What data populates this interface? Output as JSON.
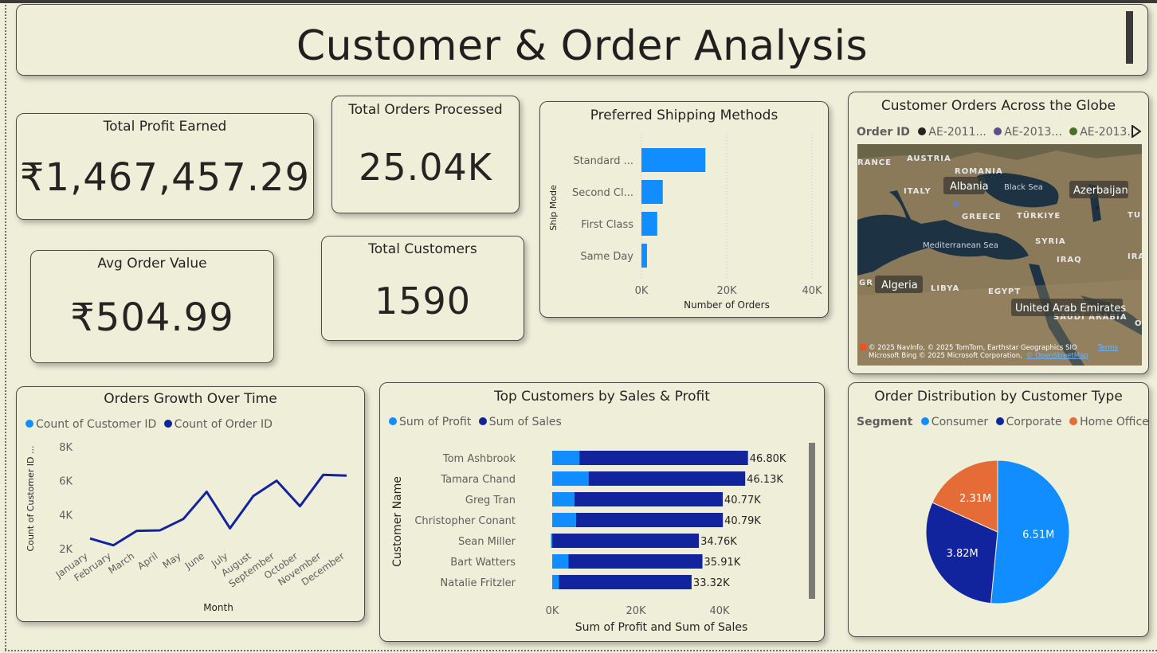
{
  "header": {
    "title": "Customer & Order Analysis"
  },
  "kpis": {
    "profit": {
      "label": "Total Profit Earned",
      "value": "₹1,467,457.29"
    },
    "orders": {
      "label": "Total Orders Processed",
      "value": "25.04K"
    },
    "aov": {
      "label": "Avg Order Value",
      "value": "₹504.99"
    },
    "customers": {
      "label": "Total Customers",
      "value": "1590"
    }
  },
  "map": {
    "title": "Customer Orders Across the Globe",
    "legend_title": "Order ID",
    "legend_items": [
      {
        "label": "AE-2011...",
        "color": "#252423"
      },
      {
        "label": "AE-2013...",
        "color": "#5b4e8c"
      },
      {
        "label": "AE-2013...",
        "color": "#4e6d2c"
      }
    ],
    "labels": {
      "ance": "RANCE",
      "austria": "AUSTRIA",
      "romania": "ROMANIA",
      "italy": "ITALY",
      "albania": "Albania",
      "blacksea": "Black Sea",
      "azerbaijan": "Azerbaijan",
      "greece": "GREECE",
      "turkiye": "TÜRKIYE",
      "turk": "TURKM",
      "syria": "SYRIA",
      "medsea": "Mediterranean Sea",
      "iraq": "IRAQ",
      "ira": "IRA",
      "gr": "GR",
      "algeria": "Algeria",
      "libya": "LIBYA",
      "egypt": "EGYPT",
      "uae": "United Arab Emirates",
      "saudi": "SAUDI ARABIA",
      "o": "O"
    },
    "attribution_1": "© 2025 NavInfo, © 2025 TomTom, Earthstar Geographics SIO",
    "attribution_terms": "Terms",
    "attribution_2": "Microsoft Bing  © 2025 Microsoft Corporation,",
    "attribution_osm": "© OpenStreetMap",
    "colors": {
      "water": "#1d3344",
      "land": "#8a7a5a"
    }
  },
  "shipping": {
    "title": "Preferred Shipping Methods",
    "chart_data": {
      "type": "bar",
      "orientation": "horizontal",
      "categories": [
        "Standard ...",
        "Second Cl...",
        "First Class",
        "Same Day"
      ],
      "values": [
        15000,
        5000,
        3700,
        1300
      ],
      "xlabel": "Number of Orders",
      "ylabel": "Ship Mode",
      "xlim": [
        0,
        40000
      ],
      "xticks": [
        "0K",
        "20K",
        "40K"
      ],
      "color": "#118dff"
    }
  },
  "growth": {
    "title": "Orders Growth Over Time",
    "legend": [
      {
        "label": "Count of Customer ID",
        "color": "#118dff"
      },
      {
        "label": "Count of Order ID",
        "color": "#12239e"
      }
    ],
    "chart_data": {
      "type": "line",
      "categories": [
        "January",
        "February",
        "March",
        "April",
        "May",
        "June",
        "July",
        "August",
        "September",
        "October",
        "November",
        "December"
      ],
      "series": [
        {
          "name": "Count of Order ID",
          "values": [
            2600,
            2200,
            3050,
            3080,
            3750,
            5350,
            3200,
            5100,
            6000,
            4500,
            6350,
            6300
          ]
        }
      ],
      "xlabel": "Month",
      "ylabel": "Count of Customer ID ...",
      "ylim": [
        2000,
        8000
      ],
      "yticks": [
        "2K",
        "4K",
        "6K",
        "8K"
      ],
      "color": "#12239e"
    }
  },
  "topcust": {
    "title": "Top Customers by Sales & Profit",
    "legend": [
      {
        "label": "Sum of Profit",
        "color": "#118dff"
      },
      {
        "label": "Sum of Sales",
        "color": "#12239e"
      }
    ],
    "chart_data": {
      "type": "bar",
      "orientation": "horizontal",
      "stacked": true,
      "categories": [
        "Tom Ashbrook",
        "Tamara Chand",
        "Greg Tran",
        "Christopher Conant",
        "Sean Miller",
        "Bart Watters",
        "Natalie Fritzler"
      ],
      "series": [
        {
          "name": "Sum of Profit",
          "values": [
            6500,
            8700,
            5300,
            5700,
            -300,
            3900,
            1600
          ]
        },
        {
          "name": "Sum of Sales",
          "values": [
            40300,
            37430,
            35470,
            35090,
            35060,
            32010,
            31720
          ]
        }
      ],
      "totals": [
        "46.80K",
        "46.13K",
        "40.77K",
        "40.79K",
        "34.76K",
        "35.91K",
        "33.32K"
      ],
      "xlabel": "Sum of Profit and Sum of Sales",
      "ylabel": "Customer Name",
      "xlim": [
        0,
        52000
      ],
      "xticks": [
        "0K",
        "20K",
        "40K"
      ]
    }
  },
  "segment": {
    "title": "Order Distribution by Customer Type",
    "legend_title": "Segment",
    "legend": [
      {
        "label": "Consumer",
        "color": "#118dff"
      },
      {
        "label": "Corporate",
        "color": "#12239e"
      },
      {
        "label": "Home Office",
        "color": "#e66c37"
      }
    ],
    "chart_data": {
      "type": "pie",
      "categories": [
        "Consumer",
        "Corporate",
        "Home Office"
      ],
      "values": [
        6.51,
        3.82,
        2.31
      ],
      "labels": [
        "6.51M",
        "3.82M",
        "2.31M"
      ],
      "colors": [
        "#118dff",
        "#12239e",
        "#e66c37"
      ]
    }
  }
}
